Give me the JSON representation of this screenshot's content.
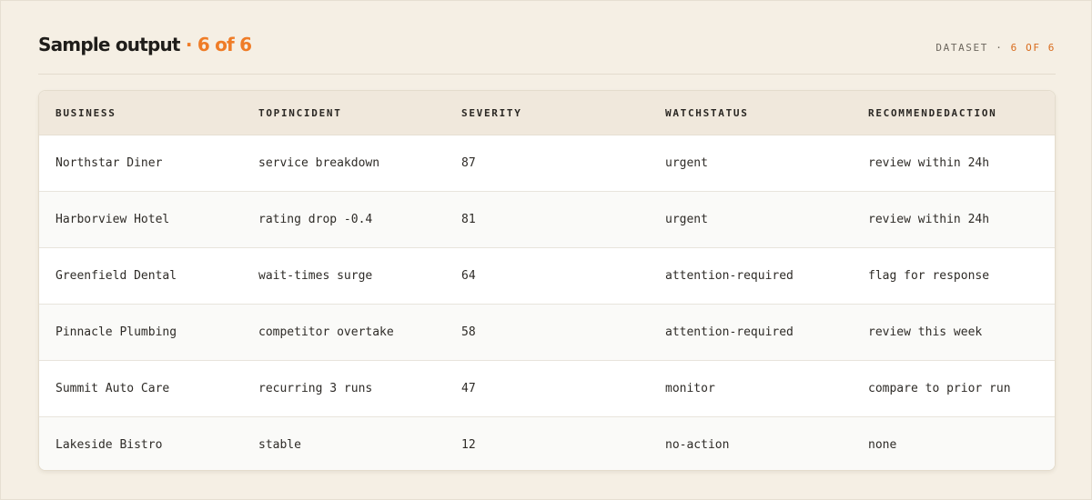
{
  "header": {
    "title": "Sample output",
    "title_accent": " · 6 of 6",
    "dataset_label": "DATASET · ",
    "dataset_count": "6 OF 6"
  },
  "table": {
    "columns": [
      "BUSINESS",
      "TOPINCIDENT",
      "SEVERITY",
      "WATCHSTATUS",
      "RECOMMENDEDACTION"
    ],
    "rows": [
      [
        "Northstar Diner",
        "service breakdown",
        "87",
        "urgent",
        "review within 24h"
      ],
      [
        "Harborview Hotel",
        "rating drop -0.4",
        "81",
        "urgent",
        "review within 24h"
      ],
      [
        "Greenfield Dental",
        "wait-times surge",
        "64",
        "attention-required",
        "flag for response"
      ],
      [
        "Pinnacle Plumbing",
        "competitor overtake",
        "58",
        "attention-required",
        "review this week"
      ],
      [
        "Summit Auto Care",
        "recurring 3 runs",
        "47",
        "monitor",
        "compare to prior run"
      ],
      [
        "Lakeside Bistro",
        "stable",
        "12",
        "no-action",
        "none"
      ]
    ]
  },
  "colors": {
    "background": "#f5efe4",
    "accent": "#ef7c27",
    "header_row": "#f0e8dc"
  }
}
